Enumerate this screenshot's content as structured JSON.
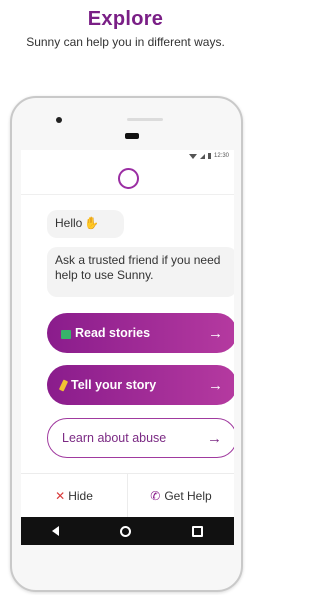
{
  "header": {
    "title": "Explore",
    "subtitle": "Sunny can help you in different ways."
  },
  "status_bar": {
    "time": "12:30"
  },
  "chat": {
    "greeting": "Hello",
    "greeting_icon": "waving-hand-icon",
    "message": "Ask a trusted friend if you need help to use Sunny."
  },
  "buttons": {
    "read_stories": "Read stories",
    "tell_story": "Tell your story",
    "learn_abuse": "Learn about abuse",
    "arrow": "→"
  },
  "footer": {
    "hide": "Hide",
    "get_help": "Get Help"
  },
  "colors": {
    "brand": "#7a1f86",
    "button_gradient_start": "#8a1c8c",
    "button_gradient_end": "#b53aa0",
    "hide_icon": "#d83c3c"
  }
}
